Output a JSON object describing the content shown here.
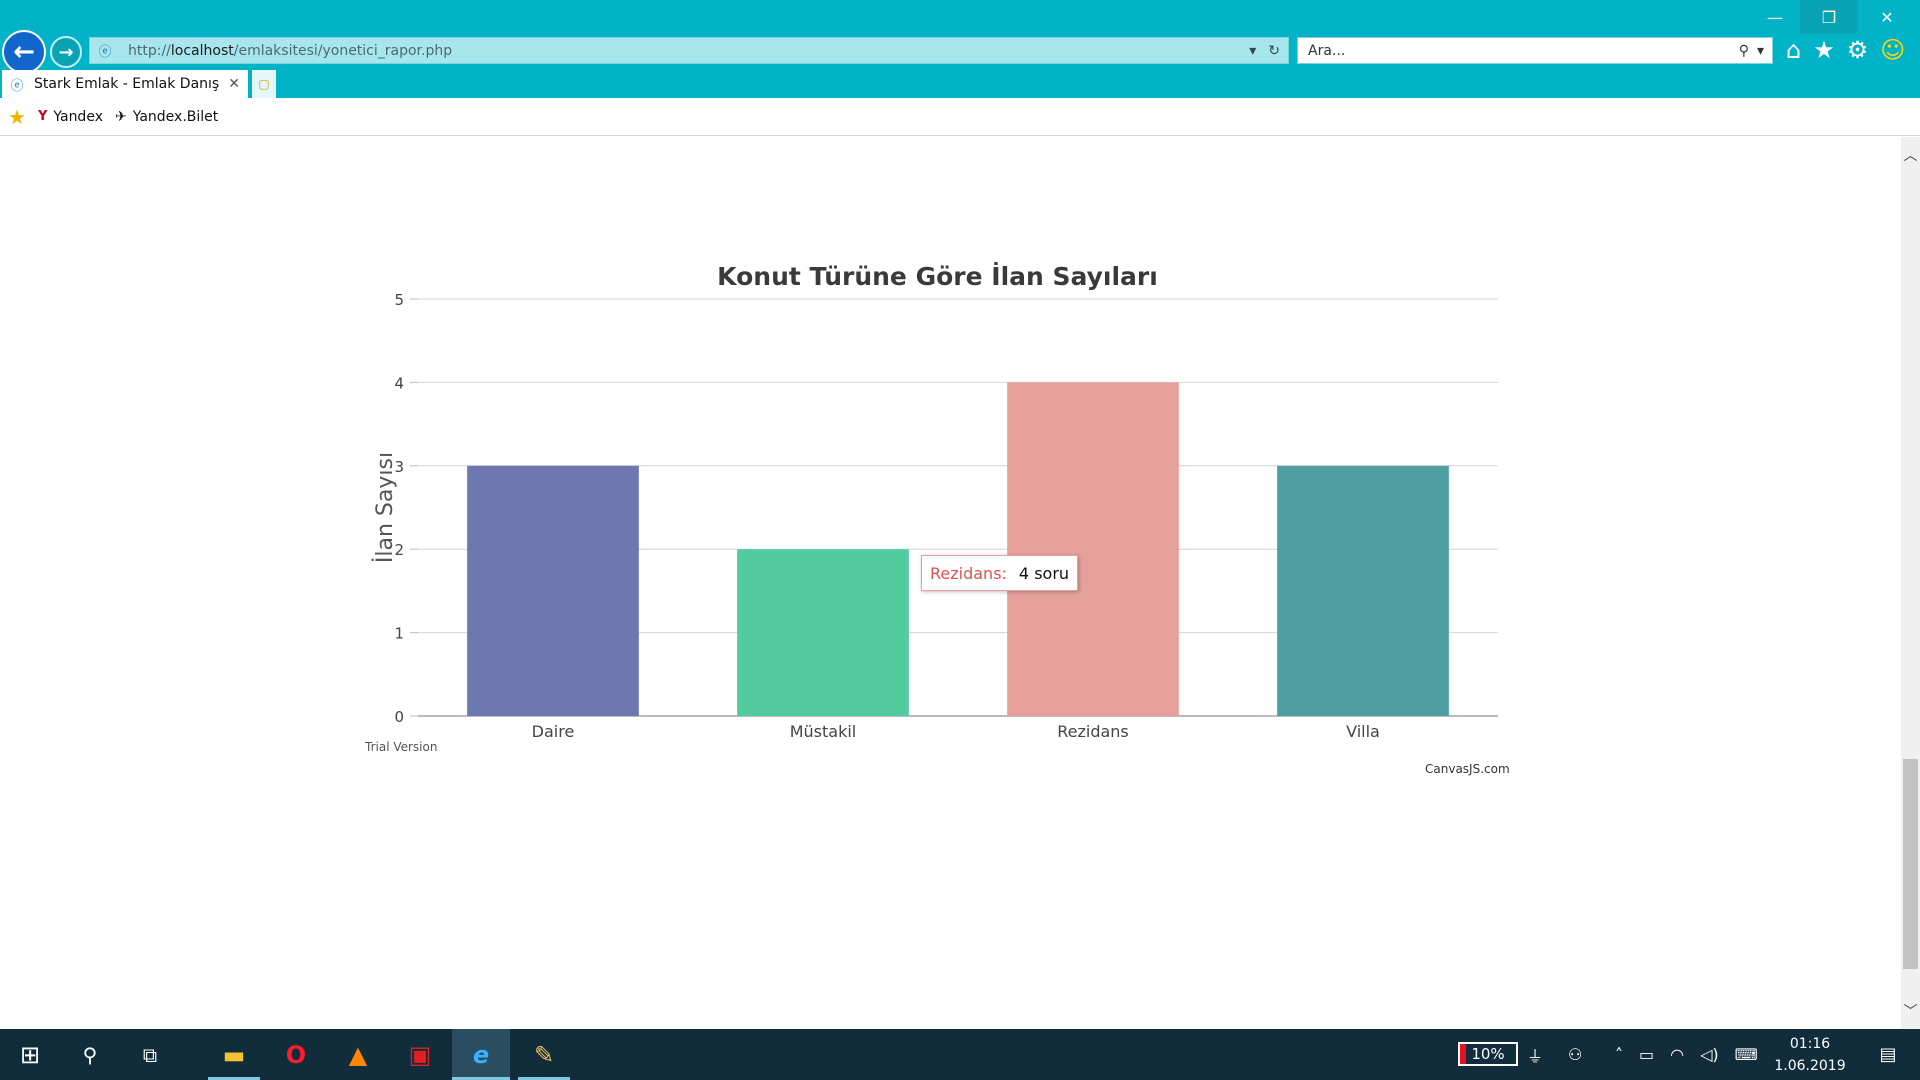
{
  "window": {
    "minimize": "—",
    "restore": "❐",
    "close": "✕"
  },
  "nav": {
    "back": "←",
    "forward": "→"
  },
  "address": {
    "scheme": "http://",
    "host": "localhost",
    "path": "/emlaksitesi/yonetici_rapor.php"
  },
  "search": {
    "placeholder": "Ara..."
  },
  "tab": {
    "title": "Stark Emlak - Emlak Danış...",
    "close": "✕"
  },
  "favorites": [
    {
      "label": "Yandex",
      "icon_glyph": "Y"
    },
    {
      "label": "Yandex.Bilet",
      "icon_glyph": "✈"
    }
  ],
  "chart_data": {
    "type": "bar",
    "title": "Konut Türüne Göre İlan Sayıları",
    "ylabel": "İlan Sayısı",
    "xlabel": "",
    "categories": [
      "Daire",
      "Müstakil",
      "Rezidans",
      "Villa"
    ],
    "values": [
      3,
      2,
      4,
      3
    ],
    "colors": [
      "#6d77b0",
      "#52cc9e",
      "#e6a09a",
      "#4f9ea2"
    ],
    "ylim": [
      0,
      5
    ],
    "yticks": [
      0,
      1,
      2,
      3,
      4,
      5
    ],
    "grid": true
  },
  "tooltip": {
    "name": "Rezidans:",
    "value": "4 soru"
  },
  "watermark": {
    "trial": "Trial Version",
    "credit": "CanvasJS.com"
  },
  "taskbar": {
    "battery": "10%",
    "battery_level": 0.1,
    "time": "01:16",
    "date": "1.06.2019"
  }
}
